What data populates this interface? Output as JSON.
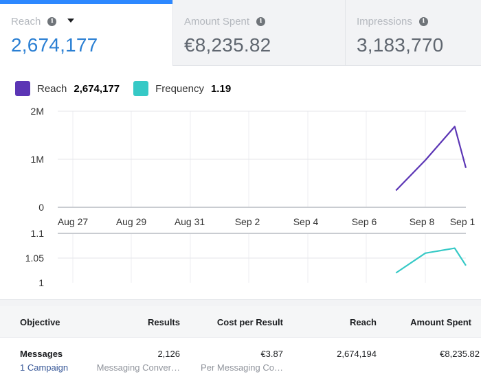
{
  "tabs": [
    {
      "label": "Reach",
      "value": "2,674,177",
      "active": true
    },
    {
      "label": "Amount Spent",
      "value": "€8,235.82",
      "active": false
    },
    {
      "label": "Impressions",
      "value": "3,183,770",
      "active": false
    }
  ],
  "legend": {
    "reach_label": "Reach",
    "reach_value": "2,674,177",
    "frequency_label": "Frequency",
    "frequency_value": "1.19"
  },
  "colors": {
    "reach": "#5b35b5",
    "frequency": "#36c9c6",
    "accent": "#2d88ff"
  },
  "icons": [
    "info-icon",
    "caret-down-icon"
  ],
  "chart_data": [
    {
      "type": "line",
      "series": [
        {
          "name": "Reach",
          "color": "#5b35b5",
          "x": [
            "Sep 7",
            "Sep 8",
            "Sep 9",
            "Sep 10"
          ],
          "values": [
            350000,
            980000,
            1680000,
            820000
          ]
        }
      ],
      "x_ticks": [
        "Aug 27",
        "Aug 29",
        "Aug 31",
        "Sep 2",
        "Sep 4",
        "Sep 6",
        "Sep 8",
        "Sep 1"
      ],
      "y_ticks": [
        "2M",
        "1M",
        "0"
      ],
      "ylim": [
        0,
        2000000
      ],
      "grid": true
    },
    {
      "type": "line",
      "series": [
        {
          "name": "Frequency",
          "color": "#36c9c6",
          "x": [
            "Sep 7",
            "Sep 8",
            "Sep 9",
            "Sep 10"
          ],
          "values": [
            1.02,
            1.06,
            1.07,
            1.035
          ]
        }
      ],
      "y_ticks": [
        "1.1",
        "1.05",
        "1"
      ],
      "ylim": [
        1,
        1.1
      ],
      "grid": true
    }
  ],
  "table": {
    "headers": [
      "Objective",
      "Results",
      "Cost per Result",
      "Reach",
      "Amount Spent"
    ],
    "rows": [
      {
        "objective": "Messages",
        "campaign_link": "1 Campaign",
        "results": "2,126",
        "results_sub": "Messaging Conver…",
        "cost": "€3.87",
        "cost_sub": "Per Messaging Co…",
        "reach": "2,674,194",
        "amount": "€8,235.82"
      }
    ]
  }
}
